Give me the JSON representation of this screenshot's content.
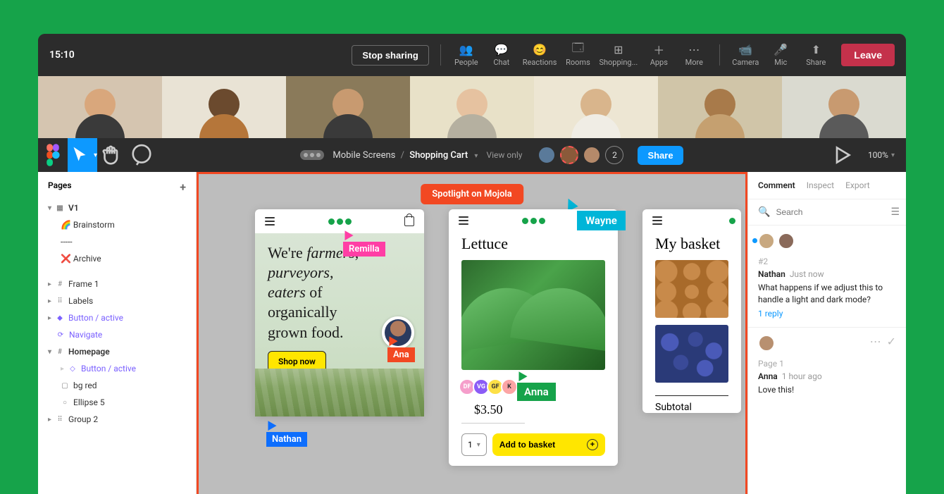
{
  "teams": {
    "time": "15:10",
    "stop_sharing": "Stop sharing",
    "icons": [
      "People",
      "Chat",
      "Reactions",
      "Rooms",
      "Shopping...",
      "Apps",
      "More"
    ],
    "device_icons": [
      "Camera",
      "Mic",
      "Share"
    ],
    "leave": "Leave"
  },
  "figma": {
    "breadcrumb_parent": "Mobile Screens",
    "breadcrumb_sep": "/",
    "breadcrumb_current": "Shopping Cart",
    "view_mode": "View only",
    "extra_count": "2",
    "share": "Share",
    "zoom": "100%"
  },
  "pages": {
    "title": "Pages",
    "items": [
      "V1",
      "🌈 Brainstorm",
      "-----",
      "❌ Archive"
    ]
  },
  "layers": [
    {
      "label": "Frame 1",
      "cls": ""
    },
    {
      "label": "Labels",
      "cls": ""
    },
    {
      "label": "Button / active",
      "cls": "purple"
    },
    {
      "label": "Navigate",
      "cls": "purple"
    },
    {
      "label": "Homepage",
      "cls": "bold"
    },
    {
      "label": "Button / active",
      "cls": "purple indent"
    },
    {
      "label": "bg red",
      "cls": "indent"
    },
    {
      "label": "Ellipse 5",
      "cls": "indent"
    },
    {
      "label": "Group 2",
      "cls": ""
    }
  ],
  "spotlight": "Spotlight on Mojola",
  "artboard1": {
    "hero_html": "We're <em>farmers</em>,<br><em>purveyors</em>,<br><em>eaters</em> of<br>organically<br>grown food.",
    "shop": "Shop now"
  },
  "artboard2": {
    "title": "Lettuce",
    "tags": [
      "DF",
      "VG",
      "GF",
      "K"
    ],
    "price": "$3.50",
    "qty": "1",
    "add": "Add to basket"
  },
  "artboard3": {
    "title": "My basket",
    "subtotal_label": "Subtotal"
  },
  "cursors": {
    "remilla": "Remilla",
    "ana": "Ana",
    "nathan": "Nathan",
    "wayne": "Wayne",
    "anna": "Anna"
  },
  "right": {
    "tabs": [
      "Comment",
      "Inspect",
      "Export"
    ],
    "search_placeholder": "Search",
    "comments": [
      {
        "num": "#2",
        "author": "Nathan",
        "time": "Just now",
        "body": "What happens if we adjust this to handle a light and dark mode?",
        "reply": "1 reply",
        "page": ""
      },
      {
        "num": "",
        "author": "Anna",
        "time": "1 hour ago",
        "body": "Love this!",
        "reply": "",
        "page": "Page 1"
      }
    ]
  }
}
